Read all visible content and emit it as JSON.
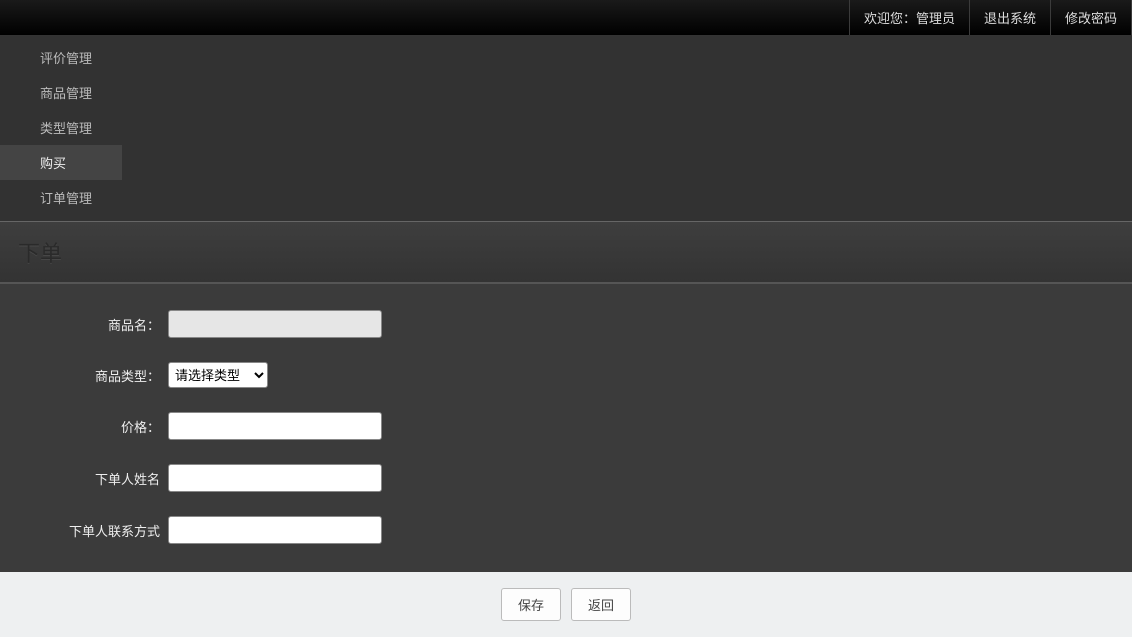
{
  "topbar": {
    "welcome": "欢迎您：管理员",
    "logout": "退出系统",
    "change_pw": "修改密码"
  },
  "nav": {
    "items": [
      {
        "label": "评价管理",
        "active": false
      },
      {
        "label": "商品管理",
        "active": false
      },
      {
        "label": "类型管理",
        "active": false
      },
      {
        "label": "购买",
        "active": true
      },
      {
        "label": "订单管理",
        "active": false
      }
    ]
  },
  "page": {
    "title": "下单"
  },
  "form": {
    "product_name_label": "商品名：",
    "product_name_value": "",
    "product_type_label": "商品类型：",
    "product_type_selected": "请选择类型",
    "price_label": "价格：",
    "price_value": "",
    "buyer_name_label": "下单人姓名",
    "buyer_name_value": "",
    "buyer_contact_label": "下单人联系方式",
    "buyer_contact_value": ""
  },
  "actions": {
    "save": "保存",
    "back": "返回"
  }
}
